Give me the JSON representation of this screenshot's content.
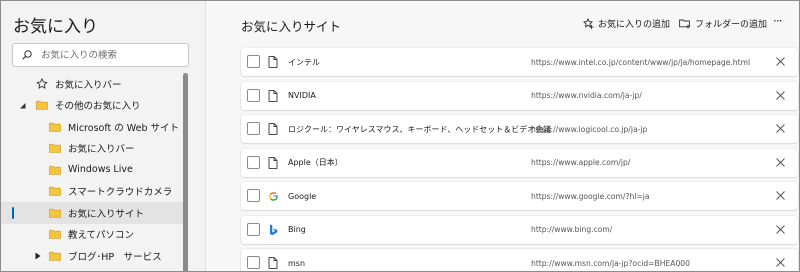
{
  "sidebar": {
    "title": "お気に入り",
    "search_placeholder": "お気に入りの検索",
    "items": [
      {
        "label": "お気に入りバー",
        "icon": "star-icon",
        "level": 0,
        "caret": "",
        "selected": false
      },
      {
        "label": "その他のお気に入り",
        "icon": "folder-icon",
        "level": 0,
        "caret": "expanded",
        "selected": false
      },
      {
        "label": "Microsoft の Web サイト",
        "icon": "folder-icon",
        "level": 1,
        "caret": "",
        "selected": false
      },
      {
        "label": "お気に入りバー",
        "icon": "folder-icon",
        "level": 1,
        "caret": "",
        "selected": false
      },
      {
        "label": "Windows Live",
        "icon": "folder-icon",
        "level": 1,
        "caret": "",
        "selected": false
      },
      {
        "label": "スマートクラウドカメラ",
        "icon": "folder-icon",
        "level": 1,
        "caret": "",
        "selected": false
      },
      {
        "label": "お気に入りサイト",
        "icon": "folder-icon",
        "level": 1,
        "caret": "",
        "selected": true
      },
      {
        "label": "教えてパソコン",
        "icon": "folder-icon",
        "level": 1,
        "caret": "",
        "selected": false
      },
      {
        "label": "ブログ･HP　サービス",
        "icon": "folder-icon",
        "level": 1,
        "caret": "collapsed",
        "selected": false
      }
    ]
  },
  "main": {
    "title": "お気に入りサイト",
    "add_favorite_label": "お気に入りの追加",
    "add_folder_label": "フォルダーの追加",
    "more_label": "···",
    "favorites": [
      {
        "name": "インテル",
        "url": "https://www.intel.co.jp/content/www/jp/ja/homepage.html",
        "icon": "page-icon"
      },
      {
        "name": "NVIDIA",
        "url": "https://www.nvidia.com/ja-jp/",
        "icon": "page-icon"
      },
      {
        "name": "ロジクール：ワイヤレスマウス、キーボード、ヘッドセット＆ビデオ会議",
        "url": "https://www.logicool.co.jp/ja-jp",
        "icon": "page-icon"
      },
      {
        "name": "Apple（日本）",
        "url": "https://www.apple.com/jp/",
        "icon": "page-icon"
      },
      {
        "name": "Google",
        "url": "https://www.google.com/?hl=ja",
        "icon": "google-icon"
      },
      {
        "name": "Bing",
        "url": "http://www.bing.com/",
        "icon": "bing-icon"
      },
      {
        "name": "msn",
        "url": "http://www.msn.com/ja-jp?ocid=BHEA000",
        "icon": "page-icon"
      }
    ]
  },
  "colors": {
    "accent": "#0067c0",
    "folder": "#f5c542",
    "sidebar_bg": "#f3f3f3",
    "main_bg": "#f7f7f7"
  }
}
